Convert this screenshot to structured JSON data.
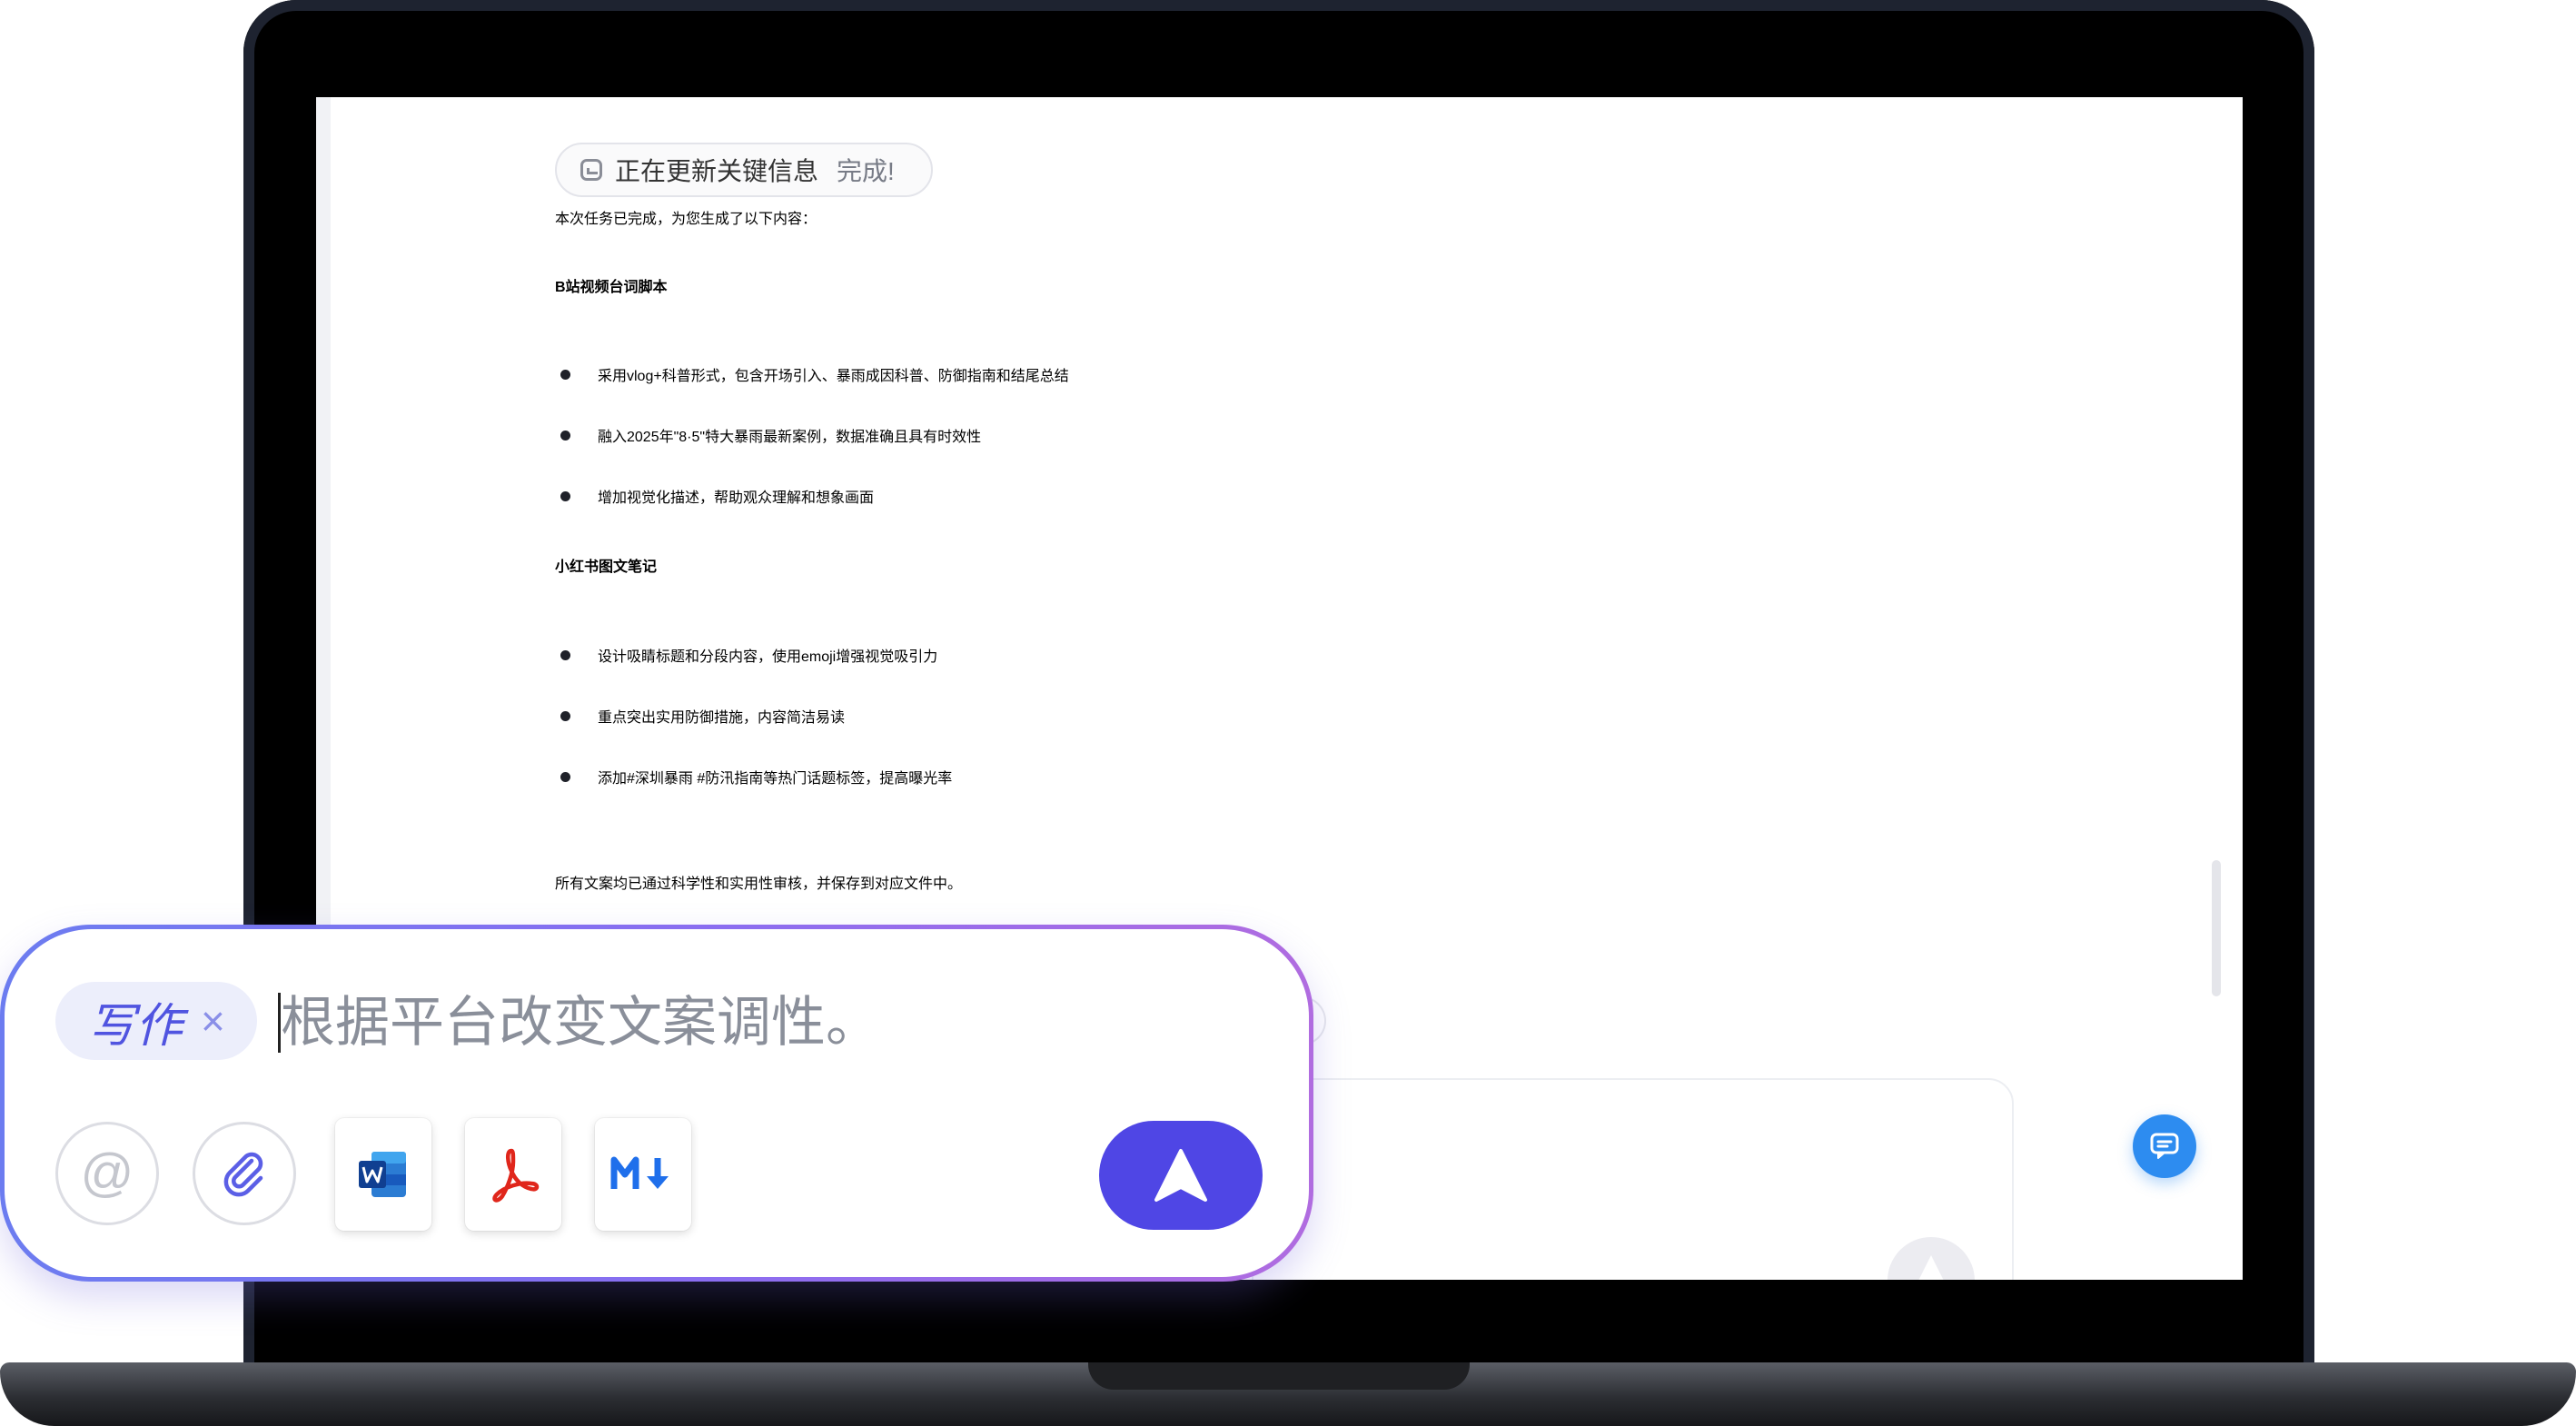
{
  "status": {
    "text": "正在更新关键信息",
    "done": "完成!"
  },
  "intro": "本次任务已完成，为您生成了以下内容：",
  "sections": [
    {
      "heading": "B站视频台词脚本",
      "bullets": [
        "采用vlog+科普形式，包含开场引入、暴雨成因科普、防御指南和结尾总结",
        "融入2025年\"8·5\"特大暴雨最新案例，数据准确且具有时效性",
        "增加视觉化描述，帮助观众理解和想象画面"
      ]
    },
    {
      "heading": "小红书图文笔记",
      "bullets": [
        "设计吸睛标题和分段内容，使用emoji增强视觉吸引力",
        "重点突出实用防御措施，内容简洁易读",
        "添加#深圳暴雨 #防汛指南等热门话题标签，提高曝光率"
      ]
    }
  ],
  "outro": "所有文案均已通过科学性和实用性审核，并保存到对应文件中。",
  "composer": {
    "tag": "写作",
    "tag_close": "×",
    "prompt": "根据平台改变文案调性。",
    "mention_symbol": "@",
    "attachments": [
      "word-file-icon",
      "pdf-file-icon",
      "markdown-file-icon"
    ]
  },
  "colors": {
    "accent": "#4f46e5",
    "composer_border_start": "#6c7cf0",
    "composer_border_end": "#b06ce0",
    "chat_fab": "#2d8cf0"
  }
}
